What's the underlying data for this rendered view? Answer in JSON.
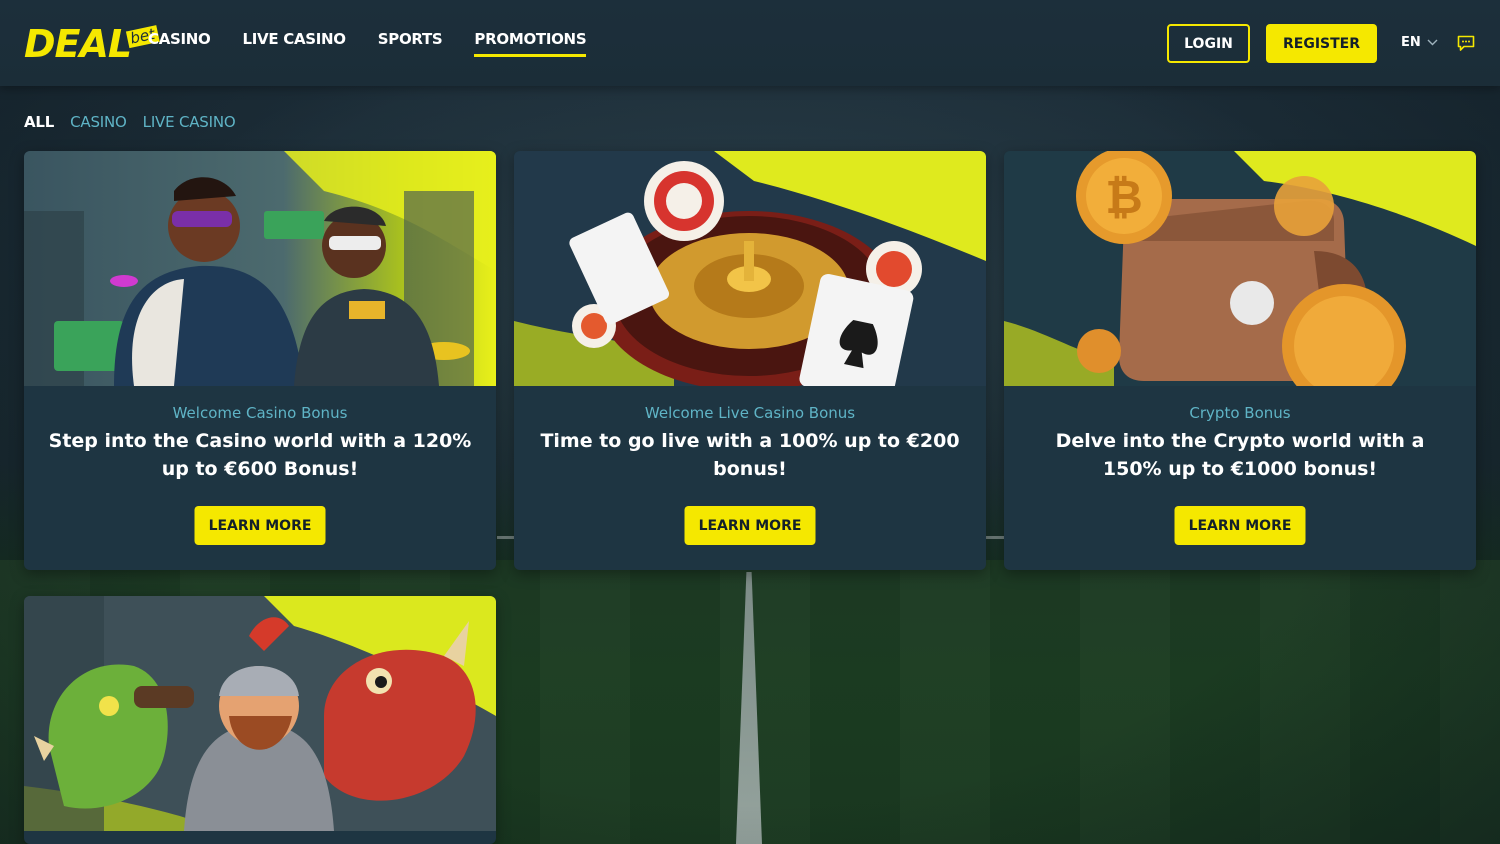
{
  "brand": {
    "logo_main": "DEAL",
    "logo_sub": "bet",
    "accent": "#f5e800",
    "link_color": "#5fb4c6"
  },
  "nav": {
    "items": [
      {
        "label": "CASINO",
        "active": false
      },
      {
        "label": "LIVE CASINO",
        "active": false
      },
      {
        "label": "SPORTS",
        "active": false
      },
      {
        "label": "PROMOTIONS",
        "active": true
      }
    ]
  },
  "header": {
    "login_label": "LOGIN",
    "register_label": "REGISTER",
    "language": "EN"
  },
  "filters": [
    {
      "label": "ALL",
      "active": true
    },
    {
      "label": "CASINO",
      "active": false
    },
    {
      "label": "LIVE CASINO",
      "active": false
    }
  ],
  "promos": [
    {
      "subtitle": "Welcome Casino Bonus",
      "title": "Step into the Casino world with a 120% up to €600 Bonus!",
      "button": "LEARN MORE"
    },
    {
      "subtitle": "Welcome Live Casino Bonus",
      "title": "Time to go live with a 100% up to €200 bonus!",
      "button": "LEARN MORE"
    },
    {
      "subtitle": "Crypto Bonus",
      "title": "Delve into the Crypto world with a 150% up to €1000 bonus!",
      "button": "LEARN MORE"
    }
  ]
}
